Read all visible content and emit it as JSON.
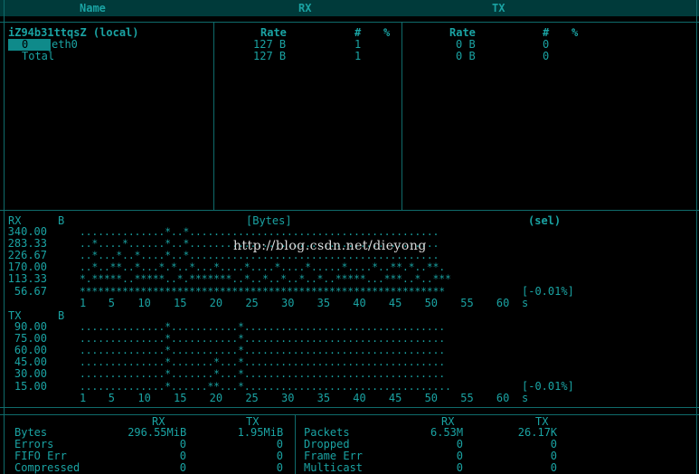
{
  "columns": {
    "name": "Name",
    "rx": "RX",
    "tx": "TX"
  },
  "iface_table": {
    "host": "iZ94b31ttqsZ (local)",
    "rx_headers": [
      "Rate",
      "#",
      "%"
    ],
    "tx_headers": [
      "Rate",
      "#",
      "%"
    ],
    "rows": [
      {
        "index": "0",
        "name": "eth0",
        "rx_rate": "127 B",
        "rx_count": "1",
        "tx_rate": "0 B",
        "tx_count": "0"
      },
      {
        "index": "",
        "name": "Total",
        "rx_rate": "127 B",
        "rx_count": "1",
        "tx_rate": "0 B",
        "tx_count": "0"
      }
    ]
  },
  "graph": {
    "unit_label": "[Bytes]",
    "sel_label": "(sel)",
    "rx": {
      "label": "RX",
      "unit": "B",
      "y_labels": [
        "340.00",
        "283.33",
        "226.67",
        "170.00",
        "113.33",
        "56.67"
      ],
      "rows": [
        "..............*..*.........................................",
        "..*....*......*..*.........................................",
        "..*...*..*....*..*.........................................",
        "..*..**..*...*.*..*...*....*....*....*.....*....*..**.*..**.",
        "*.*****..*****..*.*******..*..*..*..*..*..*****...***..*..***",
        "************************************************************"
      ],
      "rate": "[-0.01%]"
    },
    "tx": {
      "label": "TX",
      "unit": "B",
      "y_labels": [
        "90.00",
        "75.00",
        "60.00",
        "45.00",
        "30.00",
        "15.00"
      ],
      "rows": [
        "..............*...........*.................................",
        "..............*...........*.................................",
        "..............*...........*.................................",
        "..............*.......*...*.................................",
        "..............*.......*...*.................................",
        "..............*......**...*.................................."
      ],
      "rate": "[-0.01%]"
    },
    "x_ticks": [
      "1",
      "5",
      "10",
      "15",
      "20",
      "25",
      "30",
      "35",
      "40",
      "45",
      "50",
      "55",
      "60"
    ],
    "x_unit": "s"
  },
  "watermark": "http://blog.csdn.net/dieyong",
  "stats": {
    "left_headers": [
      "RX",
      "TX"
    ],
    "left": [
      {
        "label": "Bytes",
        "rx": "296.55MiB",
        "tx": "1.95MiB"
      },
      {
        "label": "Errors",
        "rx": "0",
        "tx": "0"
      },
      {
        "label": "FIFO Err",
        "rx": "0",
        "tx": "0"
      },
      {
        "label": "Compressed",
        "rx": "0",
        "tx": "0"
      }
    ],
    "right_headers": [
      "RX",
      "TX"
    ],
    "right": [
      {
        "label": "Packets",
        "rx": "6.53M",
        "tx": "26.17K"
      },
      {
        "label": "Dropped",
        "rx": "0",
        "tx": "0"
      },
      {
        "label": "Frame Err",
        "rx": "0",
        "tx": "0"
      },
      {
        "label": "Multicast",
        "rx": "0",
        "tx": "0"
      }
    ]
  }
}
